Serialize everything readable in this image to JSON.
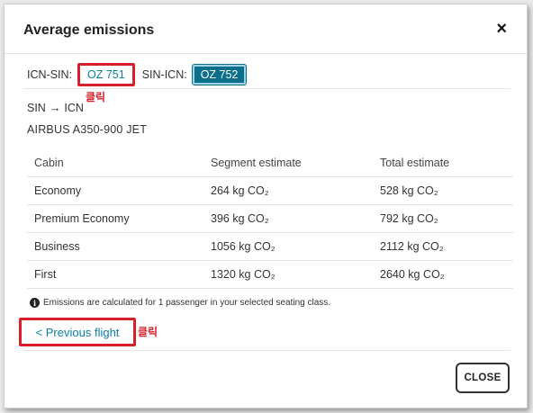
{
  "dialog": {
    "title": "Average emissions",
    "close_icon": "close-icon"
  },
  "flights": {
    "outbound_label": "ICN-SIN:",
    "outbound_flight": "OZ 751",
    "inbound_label": "SIN-ICN:",
    "inbound_flight": "OZ 752",
    "selected": "OZ 752"
  },
  "annotations": {
    "click1": "클릭",
    "click2": "클릭",
    "highlight_color": "#d9202a"
  },
  "route": {
    "from": "SIN",
    "to": "ICN",
    "arrow_icon": "arrow-right-icon",
    "aircraft": "AIRBUS A350-900 JET"
  },
  "table": {
    "headers": [
      "Cabin",
      "Segment estimate",
      "Total estimate"
    ],
    "rows": [
      [
        "Economy",
        "264 kg CO₂",
        "528 kg CO₂"
      ],
      [
        "Premium Economy",
        "396 kg CO₂",
        "792 kg CO₂"
      ],
      [
        "Business",
        "1056 kg CO₂",
        "2112 kg CO₂"
      ],
      [
        "First",
        "1320 kg CO₂",
        "2640 kg CO₂"
      ]
    ]
  },
  "note": {
    "icon": "info-icon",
    "text": "Emissions are calculated for 1 passenger in your selected seating class."
  },
  "footer": {
    "previous_link": "< Previous flight",
    "close_button": "CLOSE"
  },
  "colors": {
    "link": "#0a7fa6",
    "selected_bg": "#0b6e8a"
  }
}
